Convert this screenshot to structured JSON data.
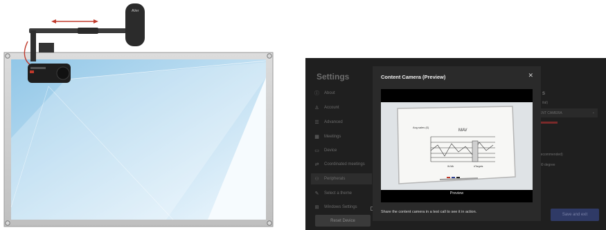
{
  "settings": {
    "title": "Settings",
    "nav_items": [
      {
        "label": "About",
        "icon": "info-icon"
      },
      {
        "label": "Account",
        "icon": "person-icon"
      },
      {
        "label": "Advanced",
        "icon": "sliders-icon"
      },
      {
        "label": "Meetings",
        "icon": "calendar-icon"
      },
      {
        "label": "Device",
        "icon": "monitor-icon"
      },
      {
        "label": "Coordinated meetings",
        "icon": "sync-icon"
      },
      {
        "label": "Peripherals",
        "icon": "peripherals-icon"
      },
      {
        "label": "Select a theme",
        "icon": "palette-icon"
      },
      {
        "label": "Windows Settings",
        "icon": "windows-icon"
      }
    ],
    "active_item": "Peripherals",
    "reset_button": "Reset Device",
    "save_exit_button": "Save and exit",
    "camera_select_value": "ENT CAMERA",
    "right_fragments": {
      "heading": "s",
      "sub": "ital)",
      "opt1": "recommended)",
      "opt2": "80 degree"
    }
  },
  "modal": {
    "title": "Content Camera (Preview)",
    "close_icon": "close-icon",
    "preview_label": "Preview",
    "description": "Share the content camera in a test call to see it in action."
  },
  "whiteboard_drawing": {
    "label_top": "MAV",
    "label_left": "Avg sales (£)",
    "label_bottom_left": "W.Wk",
    "label_bottom_right": "#Targets"
  },
  "colors": {
    "settings_bg": "#1f1f1f",
    "modal_bg": "#2a2a2a",
    "accent_button": "#2f3a66",
    "arrow_red": "#c0392b",
    "camera_light_blue": "#a8d4ee"
  }
}
